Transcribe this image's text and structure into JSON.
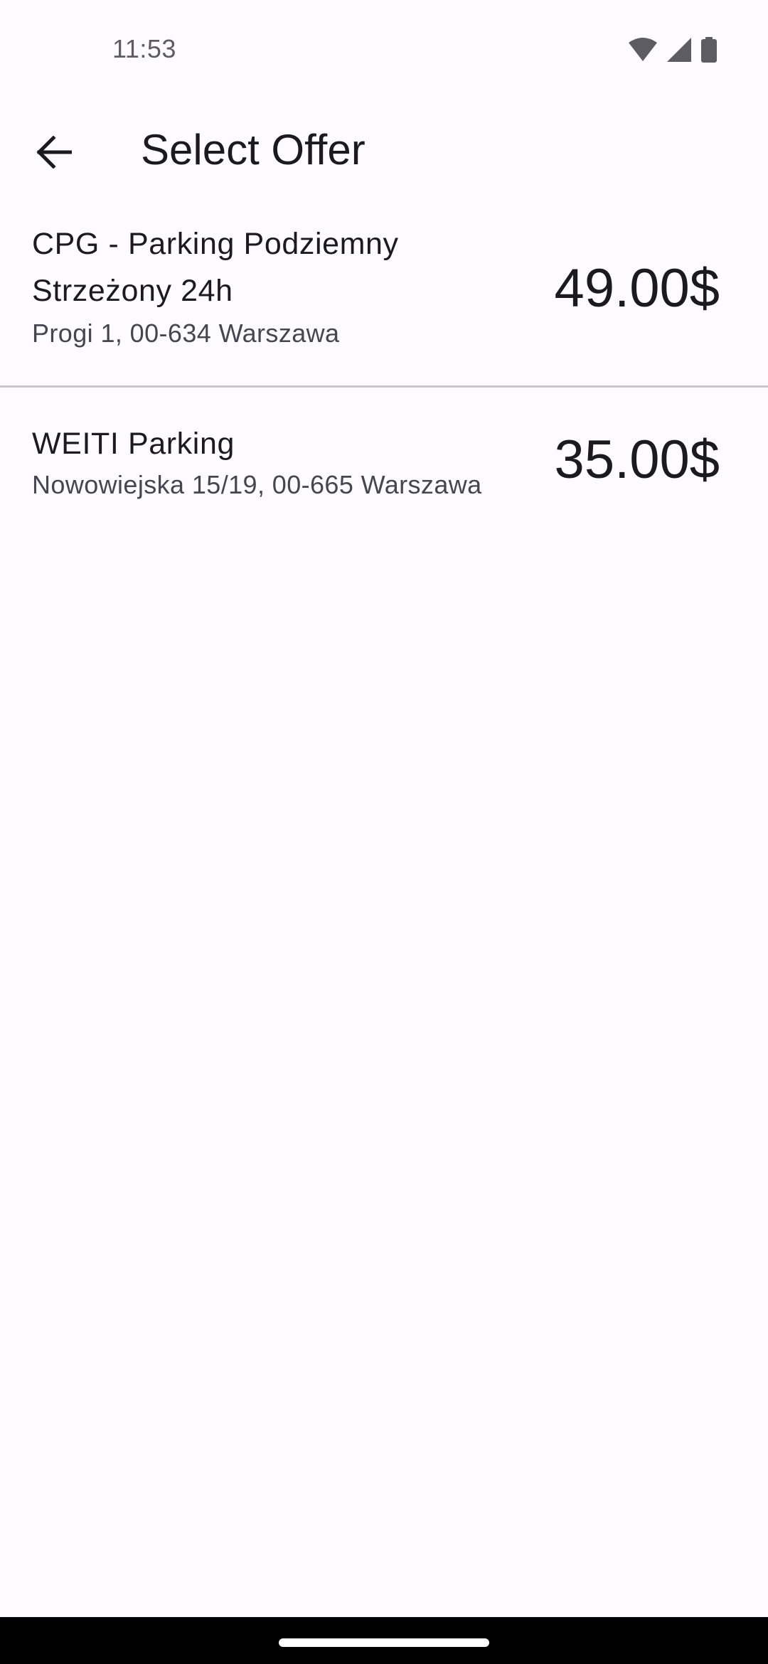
{
  "status_bar": {
    "time": "11:53",
    "icons": [
      "wifi-icon",
      "cellular-signal-icon",
      "battery-icon"
    ]
  },
  "top_bar": {
    "back_icon": "arrow-back-icon",
    "title": "Select Offer"
  },
  "offers": [
    {
      "name": "CPG - Parking Podziemny Strzeżony 24h",
      "address": "Progi 1, 00-634 Warszawa",
      "price": "49.00$"
    },
    {
      "name": "WEITI Parking",
      "address": "Nowowiejska 15/19, 00-665 Warszawa",
      "price": "35.00$"
    }
  ],
  "colors": {
    "background": "#fdfbff",
    "text_primary": "#1b1b1f",
    "text_secondary": "#46464f",
    "divider": "#c8c6cc",
    "nav_bar": "#000000"
  }
}
